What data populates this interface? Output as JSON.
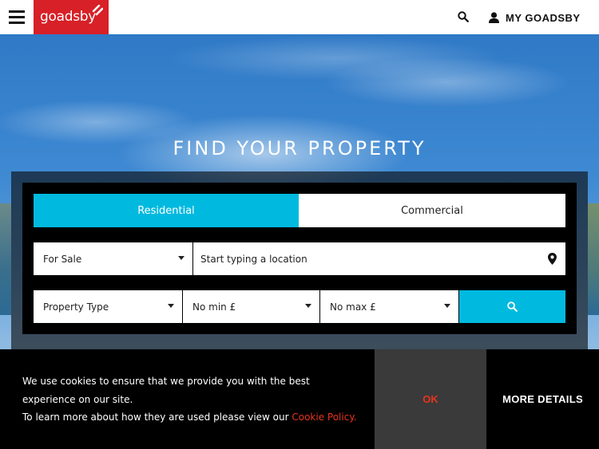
{
  "header": {
    "logo_text": "goadsby",
    "account_label": "MY GOADSBY",
    "menu_icon": "hamburger-icon",
    "search_icon": "search-icon",
    "account_icon": "user-icon"
  },
  "hero": {
    "title": "FIND YOUR PROPERTY"
  },
  "search": {
    "tabs": [
      {
        "label": "Residential",
        "active": true
      },
      {
        "label": "Commercial",
        "active": false
      }
    ],
    "sale_type": "For Sale",
    "location_placeholder": "Start typing a location",
    "property_type": "Property Type",
    "min_price": "No min £",
    "max_price": "No max £"
  },
  "cookie": {
    "line1": "We use cookies to ensure that we provide you with the best experience on our site.",
    "line2_prefix": "To learn more about how they are used please view our ",
    "link_text": "Cookie Policy.",
    "ok_label": "OK",
    "more_label": "MORE DETAILS"
  },
  "colors": {
    "brand_red": "#d72027",
    "accent_cyan": "#00b9df",
    "link_red": "#e8331f"
  }
}
